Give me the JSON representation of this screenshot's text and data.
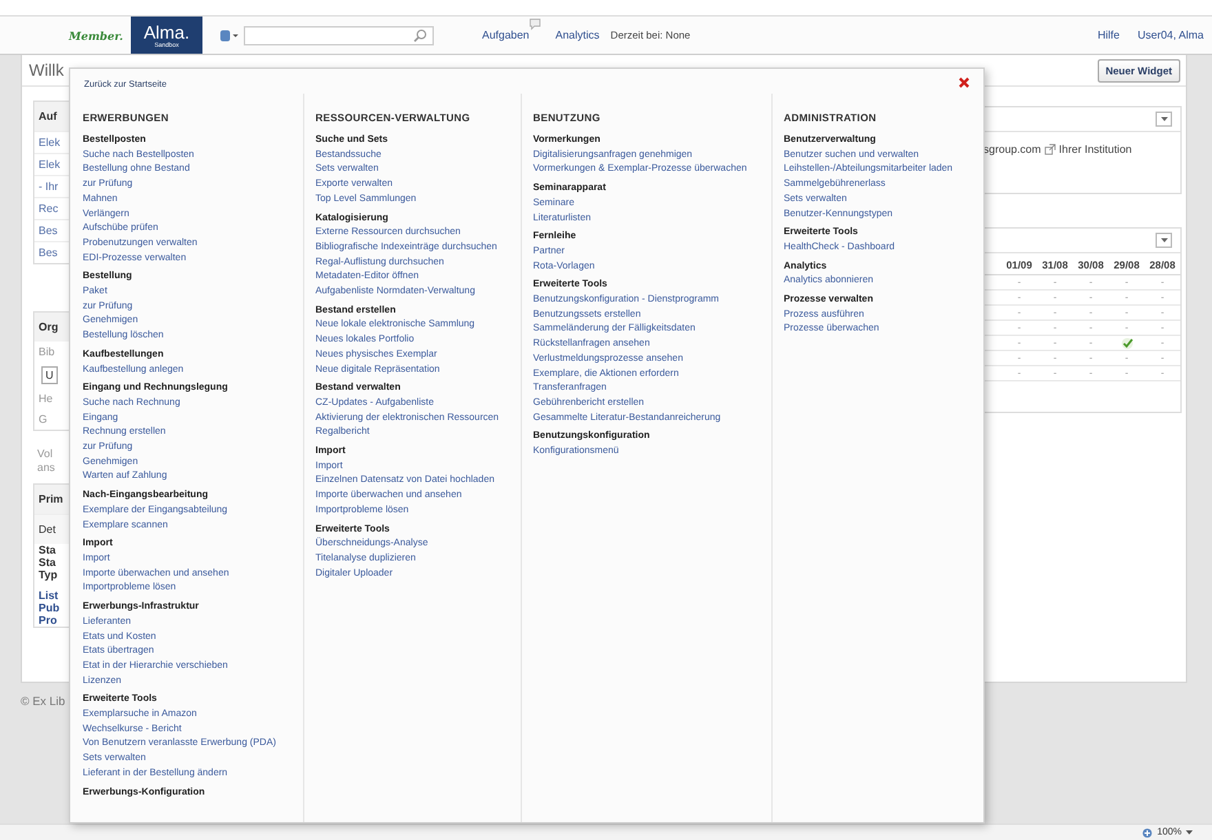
{
  "header": {
    "brand_member": "Member.",
    "brand_alma": "Alma.",
    "brand_sub": "Sandbox",
    "nav": [
      {
        "label": "Aufgaben"
      },
      {
        "label": "Analytics"
      }
    ],
    "location": "Derzeit bei: None",
    "links": [
      "Hilfe",
      "User04, Alma"
    ]
  },
  "page": {
    "title": "Willk",
    "new_widget_button": "Neuer Widget"
  },
  "left_column": [
    {
      "kind": "card",
      "title": "Auf",
      "items": [
        {
          "kind": "link",
          "text": "Elek"
        },
        {
          "kind": "link",
          "text": "Elek"
        },
        {
          "kind": "link",
          "text": "- Ihr"
        },
        {
          "kind": "link",
          "text": "Rec"
        },
        {
          "kind": "link",
          "text": "Bes"
        },
        {
          "kind": "link",
          "text": "Bes"
        }
      ]
    },
    {
      "kind": "card",
      "title": "Org",
      "items": [
        {
          "kind": "muted",
          "text": "Bib"
        },
        {
          "kind": "field",
          "text": "U"
        },
        {
          "kind": "muted",
          "text": "He"
        },
        {
          "kind": "muted",
          "text": "G"
        }
      ]
    },
    {
      "kind": "note",
      "lines": [
        "Vol",
        "ans"
      ]
    },
    {
      "kind": "card",
      "title": "Prim",
      "items": [
        {
          "kind": "subheader",
          "text": "Det"
        },
        {
          "kind": "label",
          "text": "Sta"
        },
        {
          "kind": "label",
          "text": "Sta"
        },
        {
          "kind": "label",
          "text": "Typ"
        },
        {
          "kind": "boldlink",
          "text": "List"
        },
        {
          "kind": "boldlink",
          "text": "Pub"
        },
        {
          "kind": "boldlink",
          "text": "Pro"
        }
      ]
    }
  ],
  "right_column": [
    {
      "kind": "info",
      "text_before": "sgroup.com",
      "text_after": "Ihrer Institution"
    },
    {
      "kind": "table",
      "columns": [
        "01/09",
        "31/08",
        "30/08",
        "29/08",
        "28/08"
      ],
      "rows": [
        [
          {
            "kind": "dash",
            "text": "-"
          },
          {
            "kind": "dash",
            "text": "-"
          },
          {
            "kind": "dash",
            "text": "-"
          },
          {
            "kind": "dash",
            "text": "-"
          },
          {
            "kind": "dash",
            "text": "-"
          }
        ],
        [
          {
            "kind": "dash",
            "text": "-"
          },
          {
            "kind": "dash",
            "text": "-"
          },
          {
            "kind": "dash",
            "text": "-"
          },
          {
            "kind": "dash",
            "text": "-"
          },
          {
            "kind": "dash",
            "text": "-"
          }
        ],
        [
          {
            "kind": "dash",
            "text": "-"
          },
          {
            "kind": "dash",
            "text": "-"
          },
          {
            "kind": "dash",
            "text": "-"
          },
          {
            "kind": "dash",
            "text": "-"
          },
          {
            "kind": "dash",
            "text": "-"
          }
        ],
        [
          {
            "kind": "dash",
            "text": "-"
          },
          {
            "kind": "dash",
            "text": "-"
          },
          {
            "kind": "dash",
            "text": "-"
          },
          {
            "kind": "dash",
            "text": "-"
          },
          {
            "kind": "dash",
            "text": "-"
          }
        ],
        [
          {
            "kind": "dash",
            "text": "-"
          },
          {
            "kind": "dash",
            "text": "-"
          },
          {
            "kind": "dash",
            "text": "-"
          },
          {
            "kind": "check"
          },
          {
            "kind": "dash",
            "text": "-"
          }
        ],
        [
          {
            "kind": "dash",
            "text": "-"
          },
          {
            "kind": "dash",
            "text": "-"
          },
          {
            "kind": "dash",
            "text": "-"
          },
          {
            "kind": "dash",
            "text": "-"
          },
          {
            "kind": "dash",
            "text": "-"
          }
        ],
        [
          {
            "kind": "dash",
            "text": "-"
          },
          {
            "kind": "dash",
            "text": "-"
          },
          {
            "kind": "dash",
            "text": "-"
          },
          {
            "kind": "dash",
            "text": "-"
          },
          {
            "kind": "dash",
            "text": "-"
          }
        ]
      ]
    }
  ],
  "menu": {
    "back_link": "Zurück zur Startseite",
    "columns": [
      {
        "title": "ERWERBUNGEN",
        "groups": [
          {
            "title": "Bestellposten",
            "items": [
              "Suche nach Bestellposten",
              "Bestellung ohne Bestand",
              "zur Prüfung",
              "Mahnen",
              "Verlängern",
              "Aufschübe prüfen",
              "Probenutzungen verwalten",
              "EDI-Prozesse verwalten"
            ]
          },
          {
            "title": "Bestellung",
            "items": [
              "Paket",
              "zur Prüfung",
              "Genehmigen",
              "Bestellung löschen"
            ]
          },
          {
            "title": "Kaufbestellungen",
            "items": [
              "Kaufbestellung anlegen"
            ]
          },
          {
            "title": "Eingang und Rechnungslegung",
            "items": [
              "Suche nach Rechnung",
              "Eingang",
              "Rechnung erstellen",
              "zur Prüfung",
              "Genehmigen",
              "Warten auf Zahlung"
            ]
          },
          {
            "title": "Nach-Eingangsbearbeitung",
            "items": [
              "Exemplare der Eingangsabteilung",
              "Exemplare scannen"
            ]
          },
          {
            "title": "Import",
            "items": [
              "Import",
              "Importe überwachen und ansehen",
              "Importprobleme lösen"
            ]
          },
          {
            "title": "Erwerbungs-Infrastruktur",
            "items": [
              "Lieferanten",
              "Etats und Kosten",
              "Etats übertragen",
              "Etat in der Hierarchie verschieben",
              "Lizenzen"
            ]
          },
          {
            "title": "Erweiterte Tools",
            "items": [
              "Exemplarsuche in Amazon",
              "Wechselkurse - Bericht",
              "Von Benutzern veranlasste Erwerbung (PDA)",
              "Sets verwalten",
              "Lieferant in der Bestellung ändern"
            ]
          },
          {
            "title": "Erwerbungs-Konfiguration"
          }
        ]
      },
      {
        "title": "RESSOURCEN-VERWALTUNG",
        "groups": [
          {
            "title": "Suche und Sets",
            "items": [
              "Bestandssuche",
              "Sets verwalten",
              "Exporte verwalten",
              "Top Level Sammlungen"
            ]
          },
          {
            "title": "Katalogisierung",
            "items": [
              "Externe Ressourcen durchsuchen",
              "Bibliografische Indexeinträge durchsuchen",
              "Regal-Auflistung durchsuchen",
              "Metadaten-Editor öffnen",
              "Aufgabenliste Normdaten-Verwaltung"
            ]
          },
          {
            "title": "Bestand erstellen",
            "items": [
              "Neue lokale elektronische Sammlung",
              "Neues lokales Portfolio",
              "Neues physisches Exemplar",
              "Neue digitale Repräsentation"
            ]
          },
          {
            "title": "Bestand verwalten",
            "items": [
              "CZ-Updates - Aufgabenliste",
              "Aktivierung der elektronischen Ressourcen",
              "Regalbericht"
            ]
          },
          {
            "title": "Import",
            "items": [
              "Import",
              "Einzelnen Datensatz von Datei hochladen",
              "Importe überwachen und ansehen",
              "Importprobleme lösen"
            ]
          },
          {
            "title": "Erweiterte Tools",
            "items": [
              "Überschneidungs-Analyse",
              "Titelanalyse duplizieren",
              "Digitaler Uploader"
            ]
          }
        ]
      },
      {
        "title": "BENUTZUNG",
        "groups": [
          {
            "title": "Vormerkungen",
            "items": [
              "Digitalisierungsanfragen genehmigen",
              "Vormerkungen & Exemplar-Prozesse überwachen"
            ]
          },
          {
            "title": "Seminarapparat",
            "items": [
              "Seminare",
              "Literaturlisten"
            ]
          },
          {
            "title": "Fernleihe",
            "items": [
              "Partner",
              "Rota-Vorlagen"
            ]
          },
          {
            "title": "Erweiterte Tools",
            "items": [
              "Benutzungskonfiguration - Dienstprogramm",
              "Benutzungssets erstellen",
              "Sammeländerung der Fälligkeitsdaten",
              "Rückstellanfragen ansehen",
              "Verlustmeldungsprozesse ansehen",
              "Exemplare, die Aktionen erfordern",
              "Transferanfragen",
              "Gebührenbericht erstellen",
              "Gesammelte Literatur-Bestandanreicherung"
            ]
          },
          {
            "title": "Benutzungskonfiguration",
            "items": [
              "Konfigurationsmenü"
            ]
          }
        ]
      },
      {
        "title": "ADMINISTRATION",
        "groups": [
          {
            "title": "Benutzerverwaltung",
            "items": [
              "Benutzer suchen und verwalten",
              "Leihstellen-/Abteilungsmitarbeiter laden",
              "Sammelgebührenerlass",
              "Sets verwalten",
              "Benutzer-Kennungstypen"
            ]
          },
          {
            "title": "Erweiterte Tools",
            "items": [
              "HealthCheck - Dashboard"
            ]
          },
          {
            "title": "Analytics",
            "items": [
              "Analytics abonnieren"
            ]
          },
          {
            "title": "Prozesse verwalten",
            "items": [
              "Prozess ausführen",
              "Prozesse überwachen"
            ]
          }
        ]
      }
    ]
  },
  "footer": {
    "copyright": "© Ex Lib",
    "zoom": "100%"
  }
}
